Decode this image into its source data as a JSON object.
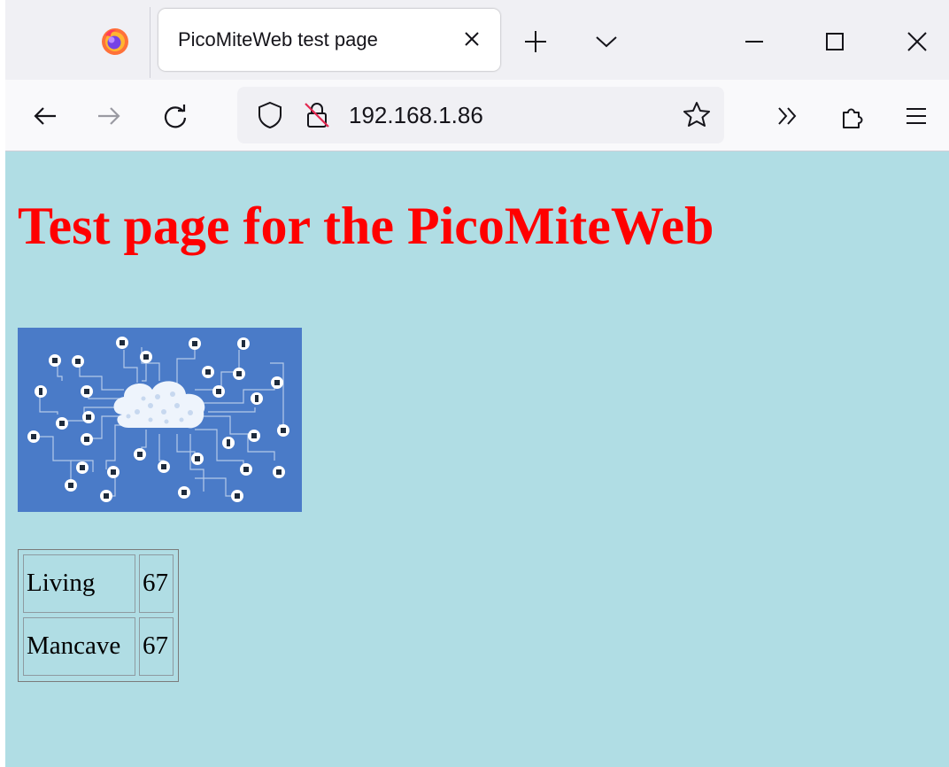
{
  "browser": {
    "tab_title": "PicoMiteWeb test page",
    "url": "192.168.1.86",
    "icons": [
      "firefox-logo",
      "close-icon",
      "plus-icon",
      "chevron-down-icon",
      "minimize-icon",
      "maximize-icon",
      "window-close-icon",
      "back-arrow-icon",
      "forward-arrow-icon",
      "reload-icon",
      "shield-icon",
      "insecure-lock-icon",
      "star-icon",
      "overflow-icon",
      "extensions-icon",
      "menu-icon"
    ]
  },
  "page": {
    "heading": "Test page for the PicoMiteWeb",
    "image_subject": "network-cloud-iot-icons",
    "background_color": "#b0dde4",
    "heading_color": "#ff0000",
    "table": [
      {
        "room": "Living",
        "value": "67"
      },
      {
        "room": "Mancave",
        "value": "67"
      }
    ]
  }
}
